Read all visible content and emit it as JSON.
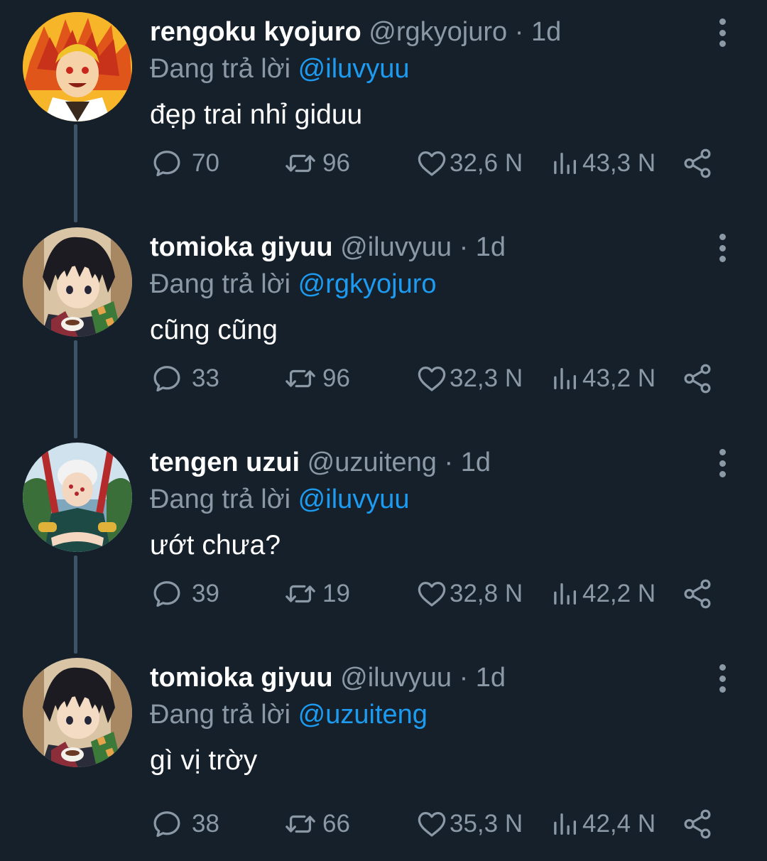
{
  "colors": {
    "background": "#15202b",
    "text_primary": "#ffffff",
    "text_secondary": "#8b98a5",
    "mention": "#1d9bf0",
    "thread_line": "#3d5466"
  },
  "icons": {
    "reply": "speech-bubble-icon",
    "retweet": "retweet-arrows-icon",
    "like": "heart-outline-icon",
    "views": "bar-chart-icon",
    "share": "share-nodes-icon",
    "more": "vertical-dots-icon"
  },
  "tweets": [
    {
      "avatar": "rengoku-avatar",
      "name": "rengoku kyojuro",
      "handle": "@rgkyojuro",
      "separator": "·",
      "time": "1d",
      "reply_prefix": "Đang trả lời",
      "reply_to": "@iluvyuu",
      "text": "đẹp trai nhỉ giduu",
      "replies": "70",
      "retweets": "96",
      "likes": "32,6 N",
      "views": "43,3 N"
    },
    {
      "avatar": "giyuu-avatar",
      "name": "tomioka giyuu",
      "handle": "@iluvyuu",
      "separator": "·",
      "time": "1d",
      "reply_prefix": "Đang trả lời",
      "reply_to": "@rgkyojuro",
      "text": "cũng cũng",
      "replies": "33",
      "retweets": "96",
      "likes": "32,3 N",
      "views": "43,2 N"
    },
    {
      "avatar": "tengen-avatar",
      "name": "tengen uzui",
      "handle": "@uzuiteng",
      "separator": "·",
      "time": "1d",
      "reply_prefix": "Đang trả lời",
      "reply_to": "@iluvyuu",
      "text": "ướt chưa?",
      "replies": "39",
      "retweets": "19",
      "likes": "32,8 N",
      "views": "42,2 N"
    },
    {
      "avatar": "giyuu-avatar",
      "name": "tomioka giyuu",
      "handle": "@iluvyuu",
      "separator": "·",
      "time": "1d",
      "reply_prefix": "Đang trả lời",
      "reply_to": "@uzuiteng",
      "text": "gì vị trờy",
      "replies": "38",
      "retweets": "66",
      "likes": "35,3 N",
      "views": "42,4 N"
    }
  ]
}
